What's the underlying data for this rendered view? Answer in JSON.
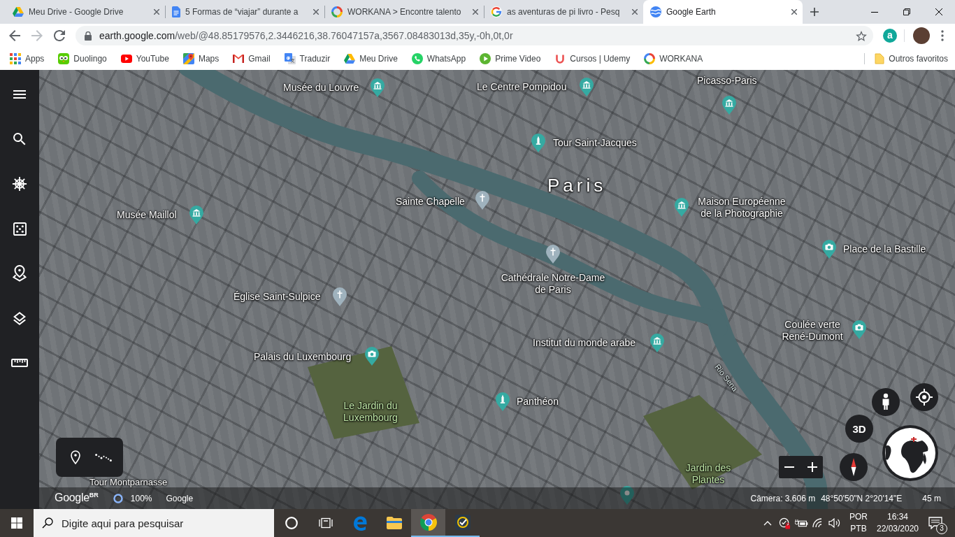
{
  "browser": {
    "tabs": [
      {
        "kind": "triangle",
        "title": "Meu Drive - Google Drive",
        "selected": false
      },
      {
        "kind": "document",
        "title": "5 Formas de “viajar” durante a",
        "selected": false
      },
      {
        "kind": "ring",
        "title": "WORKANA > Encontre talento",
        "selected": false
      },
      {
        "kind": "letter",
        "title": "as aventuras de pi livro - Pesq",
        "selected": false
      },
      {
        "kind": "globe",
        "title": "Google Earth",
        "selected": true
      }
    ],
    "back": {
      "disabled": false
    },
    "forward": {
      "disabled": true
    },
    "url": {
      "host": "earth.google.com",
      "path": "/web/@48.85179576,2.3446216,38.76047157a,3567.08483013d,35y,-0h,0t,0r"
    },
    "extension": "a",
    "bookmarks": [
      {
        "kind": "grid",
        "label": "Apps"
      },
      {
        "kind": "owl",
        "label": "Duolingo"
      },
      {
        "kind": "video",
        "label": "YouTube"
      },
      {
        "kind": "map",
        "label": "Maps"
      },
      {
        "kind": "mail",
        "label": "Gmail"
      },
      {
        "kind": "translate",
        "label": "Traduzir"
      },
      {
        "kind": "triangle",
        "label": "Meu Drive"
      },
      {
        "kind": "chat",
        "label": "WhatsApp"
      },
      {
        "kind": "play",
        "label": "Prime Video"
      },
      {
        "kind": "curve",
        "label": "Cursos | Udemy"
      },
      {
        "kind": "ring",
        "label": "WORKANA"
      }
    ],
    "other_bookmarks": "Outros favoritos"
  },
  "earth": {
    "labels": [
      {
        "kind": "museum",
        "text": "Musée du Louvre"
      },
      {
        "kind": "museum",
        "text": "Le Centre Pompidou"
      },
      {
        "kind": "museum",
        "text": "Picasso-Paris"
      },
      {
        "kind": "monument",
        "text": "Tour Saint-Jacques"
      },
      {
        "kind": "city",
        "text": "Paris"
      },
      {
        "kind": "church",
        "text": "Sainte Chapelle"
      },
      {
        "kind": "museum",
        "text": "Musée Maillol"
      },
      {
        "kind": "museum",
        "text": "Maison Européenne de la Photographie"
      },
      {
        "kind": "camera",
        "text": "Place de la Bastille"
      },
      {
        "kind": "church",
        "text": "Église Saint-Sulpice"
      },
      {
        "kind": "church",
        "text": "Cathédrale Notre-Dame de Paris"
      },
      {
        "kind": "museum",
        "text": "Institut du monde arabe"
      },
      {
        "kind": "camera",
        "text": "Coulée verte René-Dumont"
      },
      {
        "kind": "camera",
        "text": "Palais du Luxembourg"
      },
      {
        "kind": "river",
        "text": "Rio Sena"
      },
      {
        "kind": "park",
        "text": "Le Jardin du Luxembourg"
      },
      {
        "kind": "monument",
        "text": "Panthéon"
      },
      {
        "kind": "place",
        "text": "Tour Montparnasse"
      },
      {
        "kind": "park",
        "text": "Jardin des Plantes"
      }
    ],
    "view_button": "3D",
    "bottom_bar": {
      "logo": "Google$^{BR}$",
      "progress": "100%",
      "provider": "Google",
      "camera": "Câmera: 3.606 m",
      "coordinates": "48°50'50\"N 2°20'14\"E",
      "scale": "45 m"
    }
  },
  "taskbar": {
    "search_placeholder": "Digite aqui para pesquisar",
    "apps": [
      {
        "kind": "circle",
        "running": false,
        "selected": false
      },
      {
        "kind": "tasks",
        "running": false,
        "selected": false
      },
      {
        "kind": "browser",
        "running": false,
        "selected": false
      },
      {
        "kind": "folder",
        "running": false,
        "selected": false
      },
      {
        "kind": "ball",
        "running": true,
        "selected": true
      },
      {
        "kind": "check",
        "running": true,
        "selected": false
      }
    ],
    "language": "POR",
    "layout": "PTB",
    "time": "16:34",
    "date": "22/03/2020",
    "notifications": "3"
  }
}
